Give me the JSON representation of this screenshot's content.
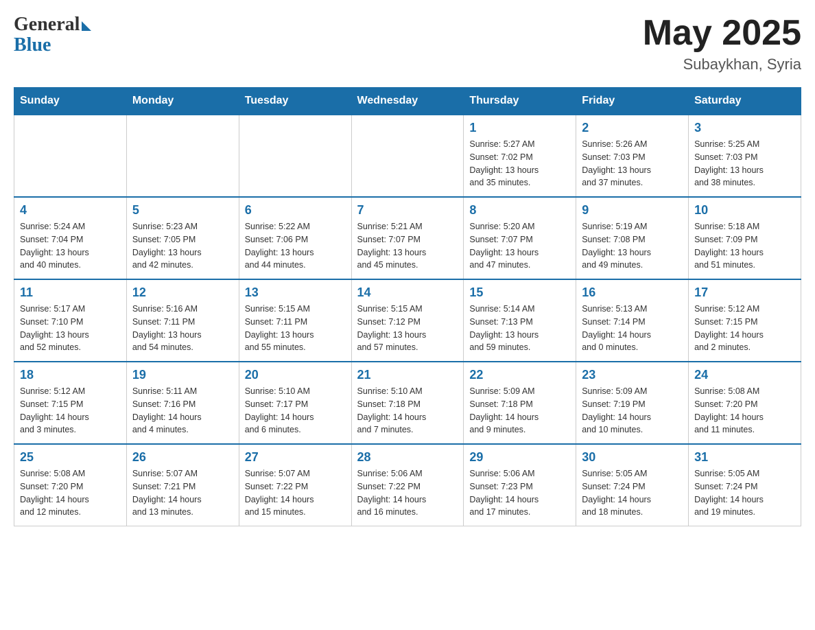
{
  "header": {
    "logo_general": "General",
    "logo_blue": "Blue",
    "title": "May 2025",
    "location": "Subaykhan, Syria"
  },
  "days_of_week": [
    "Sunday",
    "Monday",
    "Tuesday",
    "Wednesday",
    "Thursday",
    "Friday",
    "Saturday"
  ],
  "weeks": [
    [
      {
        "day": "",
        "info": ""
      },
      {
        "day": "",
        "info": ""
      },
      {
        "day": "",
        "info": ""
      },
      {
        "day": "",
        "info": ""
      },
      {
        "day": "1",
        "info": "Sunrise: 5:27 AM\nSunset: 7:02 PM\nDaylight: 13 hours\nand 35 minutes."
      },
      {
        "day": "2",
        "info": "Sunrise: 5:26 AM\nSunset: 7:03 PM\nDaylight: 13 hours\nand 37 minutes."
      },
      {
        "day": "3",
        "info": "Sunrise: 5:25 AM\nSunset: 7:03 PM\nDaylight: 13 hours\nand 38 minutes."
      }
    ],
    [
      {
        "day": "4",
        "info": "Sunrise: 5:24 AM\nSunset: 7:04 PM\nDaylight: 13 hours\nand 40 minutes."
      },
      {
        "day": "5",
        "info": "Sunrise: 5:23 AM\nSunset: 7:05 PM\nDaylight: 13 hours\nand 42 minutes."
      },
      {
        "day": "6",
        "info": "Sunrise: 5:22 AM\nSunset: 7:06 PM\nDaylight: 13 hours\nand 44 minutes."
      },
      {
        "day": "7",
        "info": "Sunrise: 5:21 AM\nSunset: 7:07 PM\nDaylight: 13 hours\nand 45 minutes."
      },
      {
        "day": "8",
        "info": "Sunrise: 5:20 AM\nSunset: 7:07 PM\nDaylight: 13 hours\nand 47 minutes."
      },
      {
        "day": "9",
        "info": "Sunrise: 5:19 AM\nSunset: 7:08 PM\nDaylight: 13 hours\nand 49 minutes."
      },
      {
        "day": "10",
        "info": "Sunrise: 5:18 AM\nSunset: 7:09 PM\nDaylight: 13 hours\nand 51 minutes."
      }
    ],
    [
      {
        "day": "11",
        "info": "Sunrise: 5:17 AM\nSunset: 7:10 PM\nDaylight: 13 hours\nand 52 minutes."
      },
      {
        "day": "12",
        "info": "Sunrise: 5:16 AM\nSunset: 7:11 PM\nDaylight: 13 hours\nand 54 minutes."
      },
      {
        "day": "13",
        "info": "Sunrise: 5:15 AM\nSunset: 7:11 PM\nDaylight: 13 hours\nand 55 minutes."
      },
      {
        "day": "14",
        "info": "Sunrise: 5:15 AM\nSunset: 7:12 PM\nDaylight: 13 hours\nand 57 minutes."
      },
      {
        "day": "15",
        "info": "Sunrise: 5:14 AM\nSunset: 7:13 PM\nDaylight: 13 hours\nand 59 minutes."
      },
      {
        "day": "16",
        "info": "Sunrise: 5:13 AM\nSunset: 7:14 PM\nDaylight: 14 hours\nand 0 minutes."
      },
      {
        "day": "17",
        "info": "Sunrise: 5:12 AM\nSunset: 7:15 PM\nDaylight: 14 hours\nand 2 minutes."
      }
    ],
    [
      {
        "day": "18",
        "info": "Sunrise: 5:12 AM\nSunset: 7:15 PM\nDaylight: 14 hours\nand 3 minutes."
      },
      {
        "day": "19",
        "info": "Sunrise: 5:11 AM\nSunset: 7:16 PM\nDaylight: 14 hours\nand 4 minutes."
      },
      {
        "day": "20",
        "info": "Sunrise: 5:10 AM\nSunset: 7:17 PM\nDaylight: 14 hours\nand 6 minutes."
      },
      {
        "day": "21",
        "info": "Sunrise: 5:10 AM\nSunset: 7:18 PM\nDaylight: 14 hours\nand 7 minutes."
      },
      {
        "day": "22",
        "info": "Sunrise: 5:09 AM\nSunset: 7:18 PM\nDaylight: 14 hours\nand 9 minutes."
      },
      {
        "day": "23",
        "info": "Sunrise: 5:09 AM\nSunset: 7:19 PM\nDaylight: 14 hours\nand 10 minutes."
      },
      {
        "day": "24",
        "info": "Sunrise: 5:08 AM\nSunset: 7:20 PM\nDaylight: 14 hours\nand 11 minutes."
      }
    ],
    [
      {
        "day": "25",
        "info": "Sunrise: 5:08 AM\nSunset: 7:20 PM\nDaylight: 14 hours\nand 12 minutes."
      },
      {
        "day": "26",
        "info": "Sunrise: 5:07 AM\nSunset: 7:21 PM\nDaylight: 14 hours\nand 13 minutes."
      },
      {
        "day": "27",
        "info": "Sunrise: 5:07 AM\nSunset: 7:22 PM\nDaylight: 14 hours\nand 15 minutes."
      },
      {
        "day": "28",
        "info": "Sunrise: 5:06 AM\nSunset: 7:22 PM\nDaylight: 14 hours\nand 16 minutes."
      },
      {
        "day": "29",
        "info": "Sunrise: 5:06 AM\nSunset: 7:23 PM\nDaylight: 14 hours\nand 17 minutes."
      },
      {
        "day": "30",
        "info": "Sunrise: 5:05 AM\nSunset: 7:24 PM\nDaylight: 14 hours\nand 18 minutes."
      },
      {
        "day": "31",
        "info": "Sunrise: 5:05 AM\nSunset: 7:24 PM\nDaylight: 14 hours\nand 19 minutes."
      }
    ]
  ]
}
